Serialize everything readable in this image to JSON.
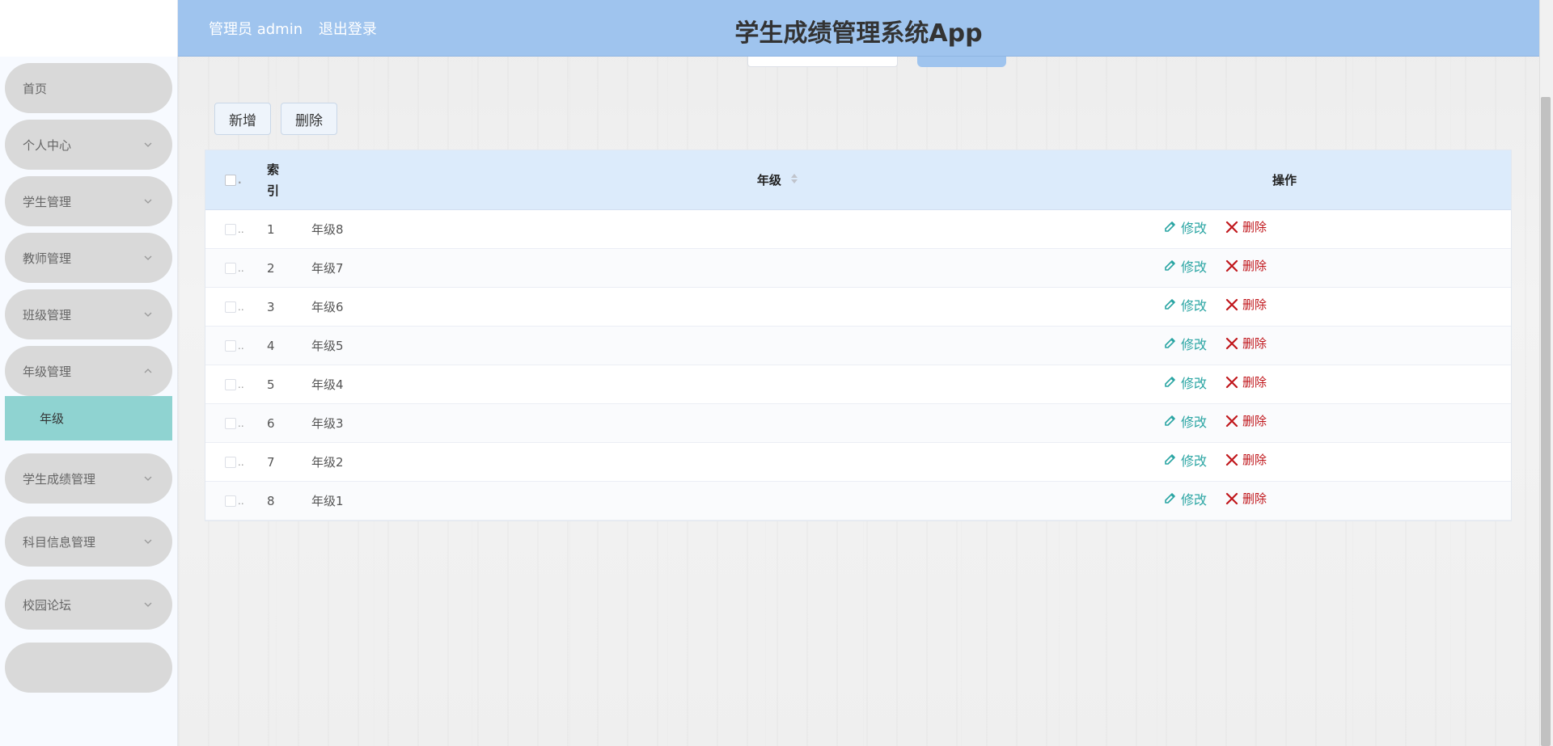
{
  "header": {
    "title": "学生成绩管理系统App",
    "user_label": "管理员 admin",
    "logout_label": "退出登录"
  },
  "sidebar": {
    "items": [
      {
        "label": "首页"
      },
      {
        "label": "个人中心"
      },
      {
        "label": "学生管理"
      },
      {
        "label": "教师管理"
      },
      {
        "label": "班级管理"
      },
      {
        "label": "年级管理"
      },
      {
        "label": "学生成绩管理"
      },
      {
        "label": "科目信息管理"
      },
      {
        "label": "校园论坛"
      }
    ],
    "active_sub": "年级"
  },
  "toolbar": {
    "add_label": "新增",
    "delete_label": "删除"
  },
  "table": {
    "headers": {
      "index": "索引",
      "grade": "年级",
      "ops": "操作"
    },
    "rows": [
      {
        "index": "1",
        "grade": "年级8"
      },
      {
        "index": "2",
        "grade": "年级7"
      },
      {
        "index": "3",
        "grade": "年级6"
      },
      {
        "index": "4",
        "grade": "年级5"
      },
      {
        "index": "5",
        "grade": "年级4"
      },
      {
        "index": "6",
        "grade": "年级3"
      },
      {
        "index": "7",
        "grade": "年级2"
      },
      {
        "index": "8",
        "grade": "年级1"
      }
    ],
    "edit_label": "修改",
    "delete_label": "删除"
  },
  "colors": {
    "header_bg": "#9fc4ee",
    "active_sub_bg": "#8fd3d1",
    "edit_color": "#2aa5a3",
    "delete_color": "#c0161b"
  }
}
